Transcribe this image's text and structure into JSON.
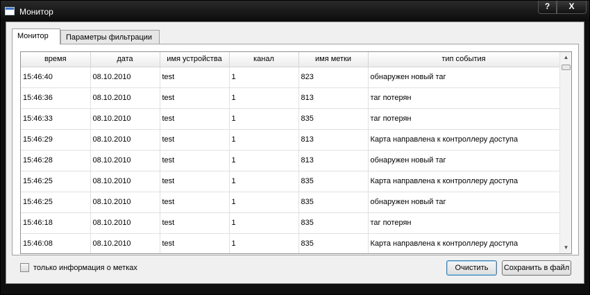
{
  "window": {
    "title": "Монитор",
    "help_label": "?",
    "close_label": "X"
  },
  "tabs": [
    {
      "label": "Монитор",
      "active": true
    },
    {
      "label": "Параметры фильтрации",
      "active": false
    }
  ],
  "table": {
    "columns": [
      "время",
      "дата",
      "имя устройства",
      "канал",
      "имя метки",
      "тип события"
    ],
    "rows": [
      [
        "15:46:40",
        "08.10.2010",
        "test",
        "1",
        "823",
        "обнаружен новый таг"
      ],
      [
        "15:46:36",
        "08.10.2010",
        "test",
        "1",
        "813",
        "таг потерян"
      ],
      [
        "15:46:33",
        "08.10.2010",
        "test",
        "1",
        "835",
        "таг потерян"
      ],
      [
        "15:46:29",
        "08.10.2010",
        "test",
        "1",
        "813",
        "Карта направлена к контроллеру доступа"
      ],
      [
        "15:46:28",
        "08.10.2010",
        "test",
        "1",
        "813",
        "обнаружен новый таг"
      ],
      [
        "15:46:25",
        "08.10.2010",
        "test",
        "1",
        "835",
        "Карта направлена к контроллеру доступа"
      ],
      [
        "15:46:25",
        "08.10.2010",
        "test",
        "1",
        "835",
        "обнаружен новый таг"
      ],
      [
        "15:46:18",
        "08.10.2010",
        "test",
        "1",
        "835",
        "таг потерян"
      ],
      [
        "15:46:08",
        "08.10.2010",
        "test",
        "1",
        "835",
        "Карта направлена к контроллеру доступа"
      ]
    ]
  },
  "scroll": {
    "up": "▲",
    "down": "▼"
  },
  "footer": {
    "checkbox_label": "только информация о метках",
    "checkbox_checked": false,
    "clear_label": "Очистить",
    "save_label": "Сохранить в файл"
  }
}
